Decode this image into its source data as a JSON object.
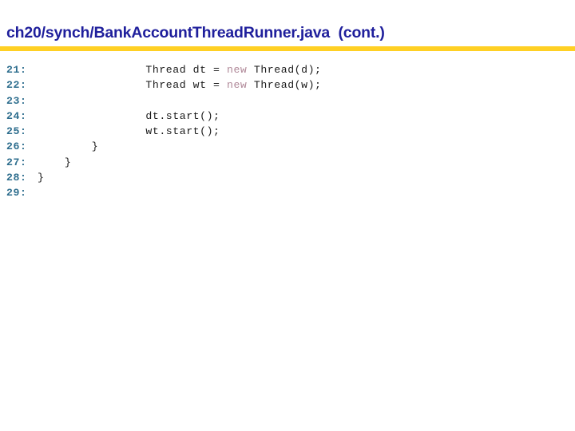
{
  "slide": {
    "title": "ch20/synch/BankAccountThreadRunner.java  (cont.)",
    "accent_bar_color": "#ffd024",
    "title_color": "#1f1f9c",
    "line_number_color": "#2e6e8e",
    "code_color": "#1a1a1a",
    "keyword_color": "#b08898",
    "background_color": "#ffffff"
  },
  "code": {
    "lines": [
      {
        "number": "21:",
        "indent": "                ",
        "before_keyword": "Thread dt = ",
        "keyword": "new",
        "after_keyword": " Thread(d);",
        "text": "                Thread dt = new Thread(d);"
      },
      {
        "number": "22:",
        "indent": "                ",
        "before_keyword": "Thread wt = ",
        "keyword": "new",
        "after_keyword": " Thread(w);",
        "text": "                Thread wt = new Thread(w);"
      },
      {
        "number": "23:",
        "indent": "",
        "before_keyword": "",
        "keyword": "",
        "after_keyword": "",
        "text": ""
      },
      {
        "number": "24:",
        "indent": "                ",
        "before_keyword": "dt.start();",
        "keyword": "",
        "after_keyword": "",
        "text": "                dt.start();"
      },
      {
        "number": "25:",
        "indent": "                ",
        "before_keyword": "wt.start();",
        "keyword": "",
        "after_keyword": "",
        "text": "                wt.start();"
      },
      {
        "number": "26:",
        "indent": "        ",
        "before_keyword": "}",
        "keyword": "",
        "after_keyword": "",
        "text": "        }"
      },
      {
        "number": "27:",
        "indent": "    ",
        "before_keyword": "}",
        "keyword": "",
        "after_keyword": "",
        "text": "    }"
      },
      {
        "number": "28:",
        "indent": "",
        "before_keyword": "}",
        "keyword": "",
        "after_keyword": "",
        "text": "}"
      },
      {
        "number": "29:",
        "indent": "",
        "before_keyword": "",
        "keyword": "",
        "after_keyword": "",
        "text": ""
      }
    ]
  }
}
